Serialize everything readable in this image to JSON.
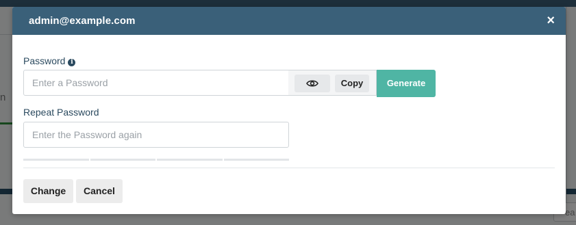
{
  "background": {
    "fragment_text": "n",
    "search_fragment": "ea"
  },
  "modal": {
    "title": "admin@example.com",
    "close_glyph": "×"
  },
  "password": {
    "label": "Password",
    "info_glyph": "i",
    "placeholder": "Enter a Password",
    "copy_label": "Copy",
    "generate_label": "Generate"
  },
  "repeat_password": {
    "label": "Repeat Password",
    "placeholder": "Enter the Password again"
  },
  "footer": {
    "change_label": "Change",
    "cancel_label": "Cancel"
  },
  "icons": {
    "visibility": "eye-icon",
    "info": "info-icon",
    "close": "close-icon"
  },
  "colors": {
    "header": "#3a6079",
    "generate": "#4fb5a4"
  }
}
